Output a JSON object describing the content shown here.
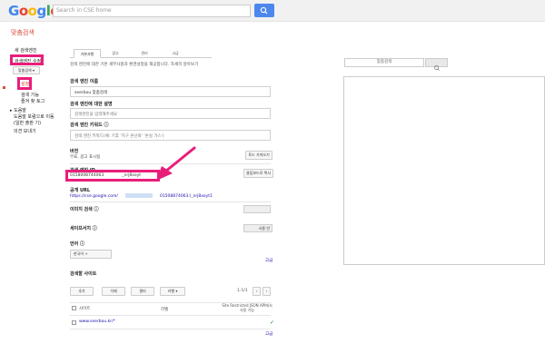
{
  "header": {
    "logo_letters": [
      "G",
      "o",
      "o",
      "g",
      "l",
      "e"
    ],
    "logo_colors": [
      "#4285f4",
      "#ea4335",
      "#fbbc05",
      "#4285f4",
      "#34a853",
      "#ea4335"
    ],
    "search_placeholder": "Search in CSE home",
    "search_icon": "magnifier-icon"
  },
  "product_title": "맞춤검색",
  "sidebar": {
    "new_engine": "새 검색엔진",
    "edit_engine": "검색엔진 수정",
    "engine_select": "맞춤검색",
    "settings": "설정",
    "items": [
      "검색 기능",
      "즐겨 찾 토그"
    ],
    "help": "도움말",
    "help_sub": [
      "도움말 포럼으로 이동",
      "(일반 출판 기)"
    ],
    "send_feedback": "의견 보내기"
  },
  "tabs": [
    "기본사항",
    "광고",
    "관리",
    "고급"
  ],
  "intro": "검색 엔진에 대한 기본 세부사항과 환경설정을 재공합니다. 자세히 알아보기",
  "intro_link": "자세히 알아보기",
  "name_label": "검색 엔진 이름",
  "name_value": "seerbou 맞춤검색",
  "desc_label": "검색 엔진에 대한 설명",
  "desc_placeholder": "검색엔진을 입력해주세요",
  "keywords_label": "검색 엔진 키워드",
  "keywords_placeholder": "검색 엔진 키워드(예: 기후 '지구 온난화' '온실 가스')",
  "edition_label": "버전",
  "edition_value": "무료, 광고 표시됨",
  "edition_btn": "토드 가져오기",
  "engine_id_label": "검색 엔진 ID",
  "engine_id_value": "0158008744063",
  "engine_id_suffix": "_nrj8xoyt",
  "copy_btn": "클립보드로 복사",
  "public_url_label": "공개 URL",
  "public_url_value": "https://cse.google.com/",
  "public_url_suffix": "01508874063:i_nrj8xoyt1",
  "image_search_label": "이미지 검색",
  "safesearch_label": "세이프서치",
  "safesearch_toggle": "사용 안",
  "region_label": "언어",
  "region_value": "한국어",
  "sites_label": "검색할 사이트",
  "sites_toolbar": [
    "추가",
    "삭제",
    "필터",
    "라벨"
  ],
  "pagination": "1-1/1",
  "table_headers": [
    "사이트",
    "라벨",
    "Site Restricted JSON API에서 사용 가능"
  ],
  "site_row": "www.seerbou.kr/*",
  "site_check": "✓",
  "advanced_link": "고급",
  "preview_placeholder": "맞춤검색"
}
